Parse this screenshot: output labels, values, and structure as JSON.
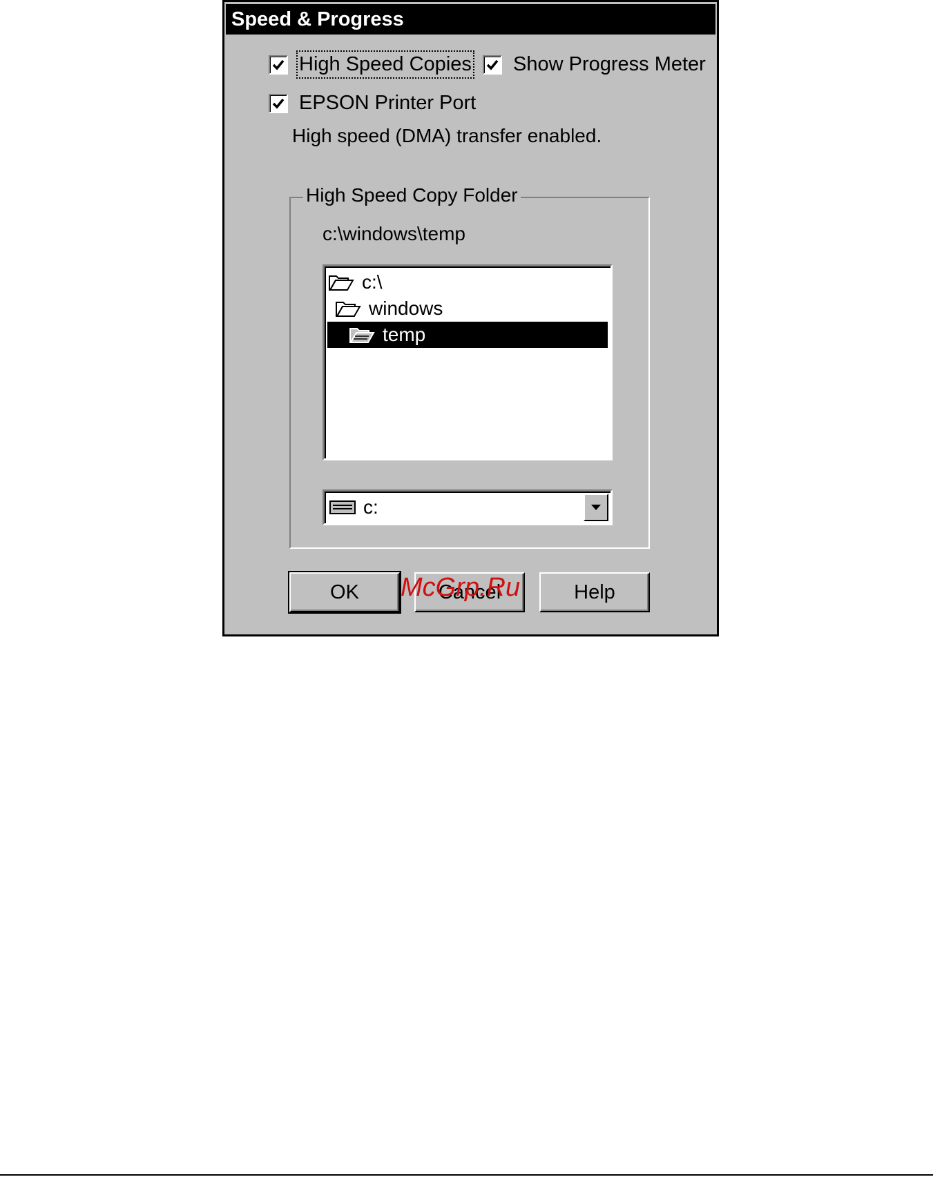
{
  "dialog": {
    "title": "Speed & Progress",
    "high_speed_copies": {
      "label": "High Speed Copies",
      "checked": true
    },
    "show_progress_meter": {
      "label": "Show Progress Meter",
      "checked": true
    },
    "epson_printer_port": {
      "label": "EPSON Printer Port",
      "checked": true
    },
    "dma_status": "High speed (DMA) transfer enabled.",
    "folder_group": {
      "legend": "High Speed Copy Folder",
      "current_path": "c:\\windows\\temp",
      "tree": [
        {
          "label": "c:\\",
          "icon": "open-folder-icon",
          "selected": false
        },
        {
          "label": "windows",
          "icon": "open-folder-icon",
          "selected": false
        },
        {
          "label": "temp",
          "icon": "open-folder-icon",
          "selected": true
        }
      ],
      "drive": {
        "value": "c:",
        "icon": "drive-icon"
      }
    },
    "buttons": {
      "ok": "OK",
      "cancel": "Cancel",
      "help": "Help"
    }
  },
  "watermark": "McGrp.Ru",
  "colors": {
    "dialog_bg": "#c0c0c0",
    "title_bg": "#000000",
    "selection_bg": "#000000",
    "watermark": "#d01010"
  }
}
